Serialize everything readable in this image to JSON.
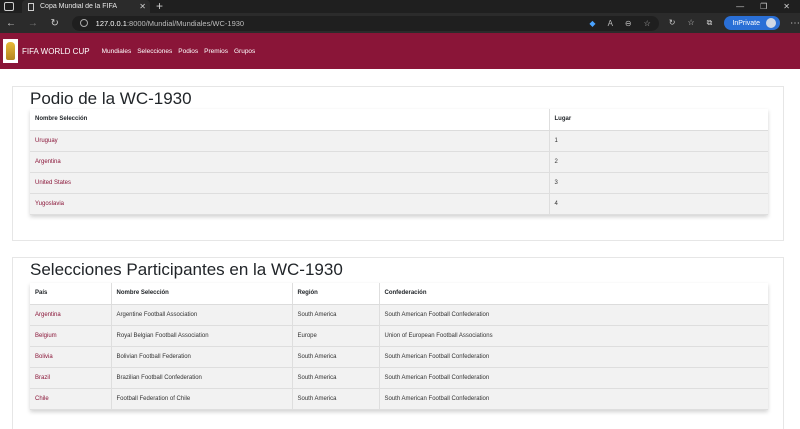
{
  "browser": {
    "tab_title": "Copa Mundial de la FIFA",
    "url_host": "127.0.0.1",
    "url_path": ":8000/Mundial/Mundiales/WC-1930",
    "inprivate_label": "InPrivate"
  },
  "navbar": {
    "brand": "FIFA WORLD CUP",
    "links": [
      "Mundiales",
      "Selecciones",
      "Podios",
      "Premios",
      "Grupos"
    ]
  },
  "podio": {
    "title": "Podio de la WC-1930",
    "headers": [
      "Nombre Selección",
      "Lugar"
    ],
    "rows": [
      {
        "team": "Uruguay",
        "place": "1"
      },
      {
        "team": "Argentina",
        "place": "2"
      },
      {
        "team": "United States",
        "place": "3"
      },
      {
        "team": "Yugoslavia",
        "place": "4"
      }
    ]
  },
  "selecciones": {
    "title": "Selecciones Participantes en la WC-1930",
    "headers": [
      "País",
      "Nombre Selección",
      "Región",
      "Confederación"
    ],
    "rows": [
      {
        "country": "Argentina",
        "name": "Argentine Football Association",
        "region": "South America",
        "confed": "South American Football Confederation"
      },
      {
        "country": "Belgium",
        "name": "Royal Belgian Football Association",
        "region": "Europe",
        "confed": "Union of European Football Associations"
      },
      {
        "country": "Bolivia",
        "name": "Bolivian Football Federation",
        "region": "South America",
        "confed": "South American Football Confederation"
      },
      {
        "country": "Brazil",
        "name": "Brazilian Football Confederation",
        "region": "South America",
        "confed": "South American Football Confederation"
      },
      {
        "country": "Chile",
        "name": "Football Federation of Chile",
        "region": "South America",
        "confed": "South American Football Confederation"
      }
    ]
  },
  "colors": {
    "brand": "#8a1538",
    "chrome_dark": "#1f1f1f",
    "inprivate_blue": "#2a6fd6"
  }
}
